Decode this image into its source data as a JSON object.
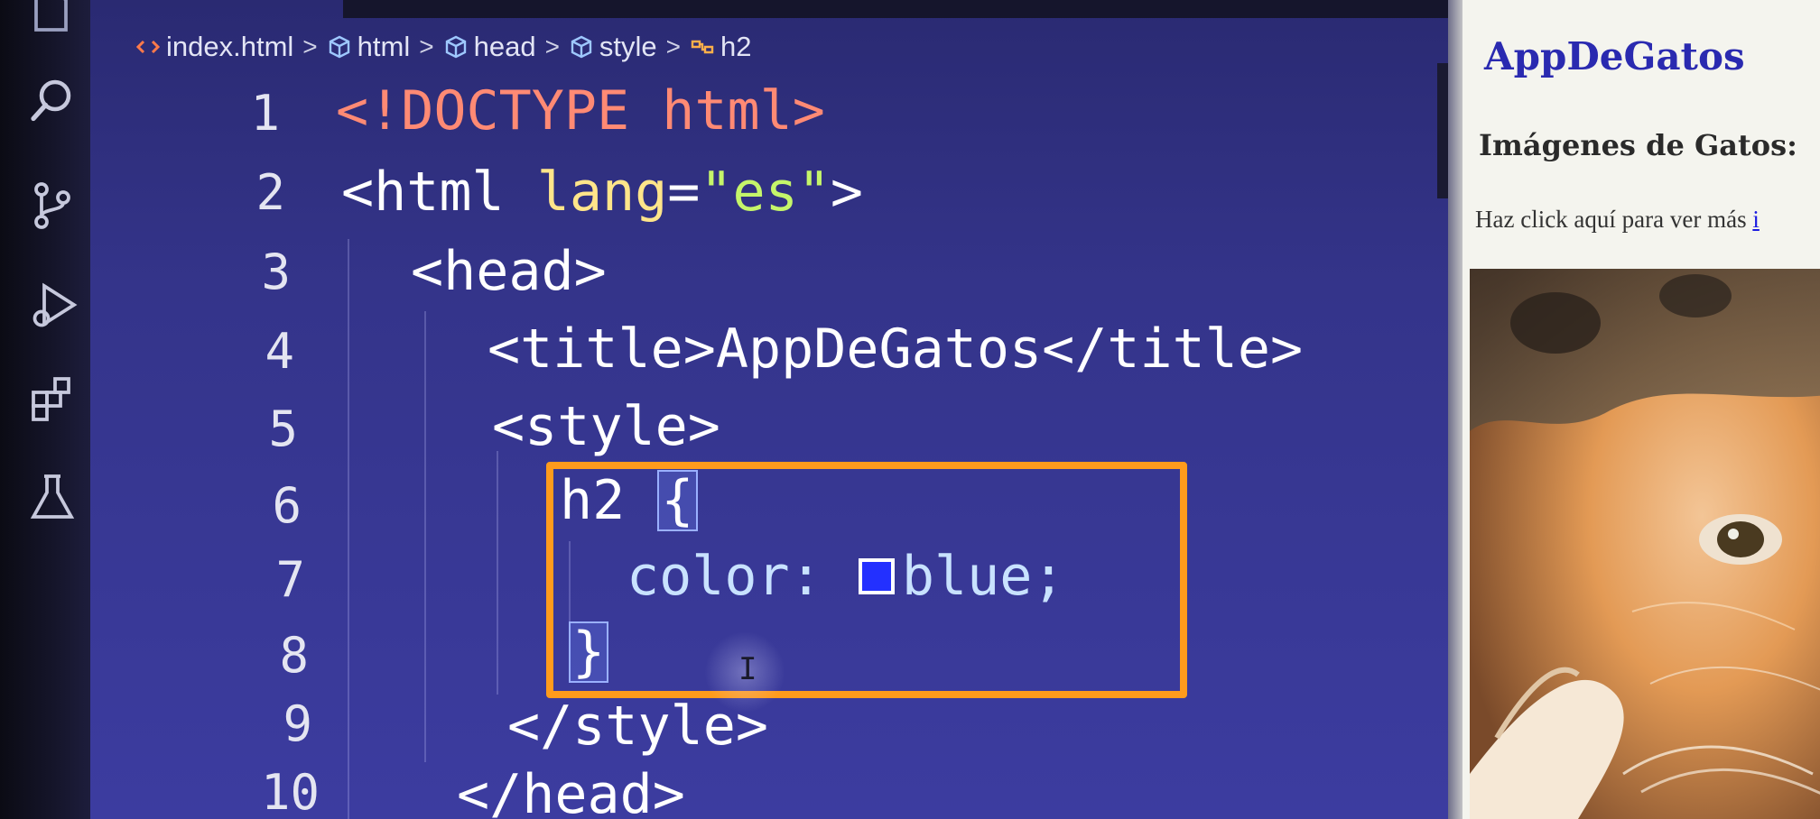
{
  "breadcrumb": {
    "items": [
      {
        "label": "index.html",
        "icon": "html-file-icon"
      },
      {
        "label": "html",
        "icon": "cube-icon"
      },
      {
        "label": "head",
        "icon": "cube-icon"
      },
      {
        "label": "style",
        "icon": "cube-icon"
      },
      {
        "label": "h2",
        "icon": "css-selector-icon"
      }
    ],
    "separator": ">"
  },
  "activity_bar": {
    "icons": [
      "explorer-icon",
      "search-icon",
      "source-control-icon",
      "run-debug-icon",
      "extensions-icon",
      "testing-icon"
    ]
  },
  "editor": {
    "line_numbers": [
      "1",
      "2",
      "3",
      "4",
      "5",
      "6",
      "7",
      "8",
      "9",
      "10"
    ],
    "code": {
      "l1": "<!DOCTYPE html>",
      "l2_open": "<",
      "l2_tag": "html",
      "l2_attr": "lang",
      "l2_eq": "=",
      "l2_val": "\"es\"",
      "l2_close": ">",
      "l3": "<head>",
      "l4_open": "<title>",
      "l4_text": "AppDeGatos",
      "l4_close": "</title>",
      "l5": "<style>",
      "l6_selector": "h2 ",
      "l6_brace": "{",
      "l7_prop": "color: ",
      "l7_value": "blue;",
      "l8_brace": "}",
      "l9": "</style>",
      "l10": "</head>"
    },
    "swatch_color": "#2330ff",
    "highlight_color": "#ff9b1c"
  },
  "preview": {
    "h1": "AppDeGatos",
    "h2": "Imágenes de Gatos:",
    "paragraph": "Haz click aquí para ver más ",
    "link": "i",
    "h1_color": "#2a2ab0"
  }
}
